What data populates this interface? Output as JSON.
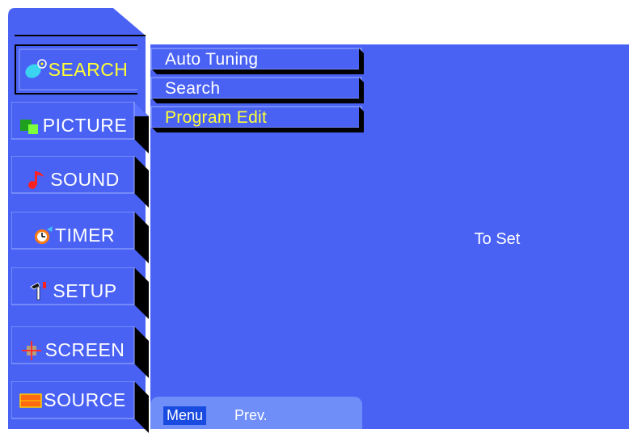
{
  "sidebar": {
    "items": [
      {
        "label": "SEARCH",
        "icon": "satellite-dish-icon",
        "active": true
      },
      {
        "label": "PICTURE",
        "icon": "picture-icon"
      },
      {
        "label": "SOUND",
        "icon": "music-note-icon"
      },
      {
        "label": "TIMER",
        "icon": "alarm-clock-icon"
      },
      {
        "label": "SETUP",
        "icon": "hammer-icon"
      },
      {
        "label": "SCREEN",
        "icon": "screen-adjust-icon"
      },
      {
        "label": "SOURCE",
        "icon": "source-input-icon"
      }
    ]
  },
  "submenu": {
    "items": [
      {
        "label": "Auto Tuning"
      },
      {
        "label": "Search"
      },
      {
        "label": "Program Edit",
        "active": true
      }
    ]
  },
  "help": {
    "menu_label": "Menu",
    "prev_label": "Prev."
  },
  "detail": {
    "text": "To Set"
  },
  "colors": {
    "panel": "#4a62f4",
    "highlight_text": "#ffff33",
    "text": "#ffffff",
    "bevel_dark": "#000000",
    "bevel_light": "#8fa3ff"
  }
}
